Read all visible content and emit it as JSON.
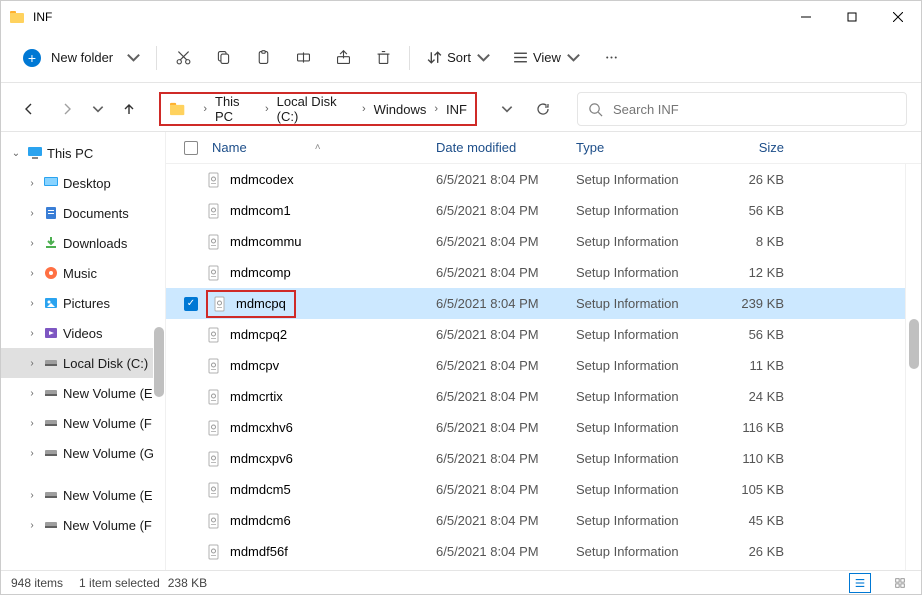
{
  "window": {
    "title": "INF"
  },
  "toolbar": {
    "new_folder": "New folder",
    "sort": "Sort",
    "view": "View"
  },
  "breadcrumbs": [
    "This PC",
    "Local Disk (C:)",
    "Windows",
    "INF"
  ],
  "search": {
    "placeholder": "Search INF"
  },
  "sidebar": [
    {
      "label": "This PC",
      "level": 1,
      "expanded": true,
      "icon": "monitor"
    },
    {
      "label": "Desktop",
      "level": 2,
      "expanded": false,
      "icon": "desktop"
    },
    {
      "label": "Documents",
      "level": 2,
      "expanded": false,
      "icon": "documents"
    },
    {
      "label": "Downloads",
      "level": 2,
      "expanded": false,
      "icon": "downloads"
    },
    {
      "label": "Music",
      "level": 2,
      "expanded": false,
      "icon": "music"
    },
    {
      "label": "Pictures",
      "level": 2,
      "expanded": false,
      "icon": "pictures"
    },
    {
      "label": "Videos",
      "level": 2,
      "expanded": false,
      "icon": "videos"
    },
    {
      "label": "Local Disk (C:)",
      "level": 2,
      "expanded": false,
      "icon": "disk",
      "selected": true
    },
    {
      "label": "New Volume (E:)",
      "level": 2,
      "expanded": false,
      "icon": "disk"
    },
    {
      "label": "New Volume (F:)",
      "level": 2,
      "expanded": false,
      "icon": "disk"
    },
    {
      "label": "New Volume (G:)",
      "level": 2,
      "expanded": false,
      "icon": "disk"
    },
    {
      "label": "New Volume (E:)",
      "level": 2,
      "expanded": false,
      "icon": "disk",
      "spacer": true
    },
    {
      "label": "New Volume (F:)",
      "level": 2,
      "expanded": false,
      "icon": "disk",
      "cut": true
    }
  ],
  "columns": {
    "name": "Name",
    "date": "Date modified",
    "type": "Type",
    "size": "Size"
  },
  "files": [
    {
      "name": "mdmcodex",
      "date": "6/5/2021 8:04 PM",
      "type": "Setup Information",
      "size": "26 KB"
    },
    {
      "name": "mdmcom1",
      "date": "6/5/2021 8:04 PM",
      "type": "Setup Information",
      "size": "56 KB"
    },
    {
      "name": "mdmcommu",
      "date": "6/5/2021 8:04 PM",
      "type": "Setup Information",
      "size": "8 KB"
    },
    {
      "name": "mdmcomp",
      "date": "6/5/2021 8:04 PM",
      "type": "Setup Information",
      "size": "12 KB"
    },
    {
      "name": "mdmcpq",
      "date": "6/5/2021 8:04 PM",
      "type": "Setup Information",
      "size": "239 KB",
      "selected": true,
      "highlight": true
    },
    {
      "name": "mdmcpq2",
      "date": "6/5/2021 8:04 PM",
      "type": "Setup Information",
      "size": "56 KB"
    },
    {
      "name": "mdmcpv",
      "date": "6/5/2021 8:04 PM",
      "type": "Setup Information",
      "size": "11 KB"
    },
    {
      "name": "mdmcrtix",
      "date": "6/5/2021 8:04 PM",
      "type": "Setup Information",
      "size": "24 KB"
    },
    {
      "name": "mdmcxhv6",
      "date": "6/5/2021 8:04 PM",
      "type": "Setup Information",
      "size": "116 KB"
    },
    {
      "name": "mdmcxpv6",
      "date": "6/5/2021 8:04 PM",
      "type": "Setup Information",
      "size": "110 KB"
    },
    {
      "name": "mdmdcm5",
      "date": "6/5/2021 8:04 PM",
      "type": "Setup Information",
      "size": "105 KB"
    },
    {
      "name": "mdmdcm6",
      "date": "6/5/2021 8:04 PM",
      "type": "Setup Information",
      "size": "45 KB"
    },
    {
      "name": "mdmdf56f",
      "date": "6/5/2021 8:04 PM",
      "type": "Setup Information",
      "size": "26 KB"
    }
  ],
  "status": {
    "count": "948 items",
    "selected": "1 item selected",
    "size": "238 KB"
  }
}
